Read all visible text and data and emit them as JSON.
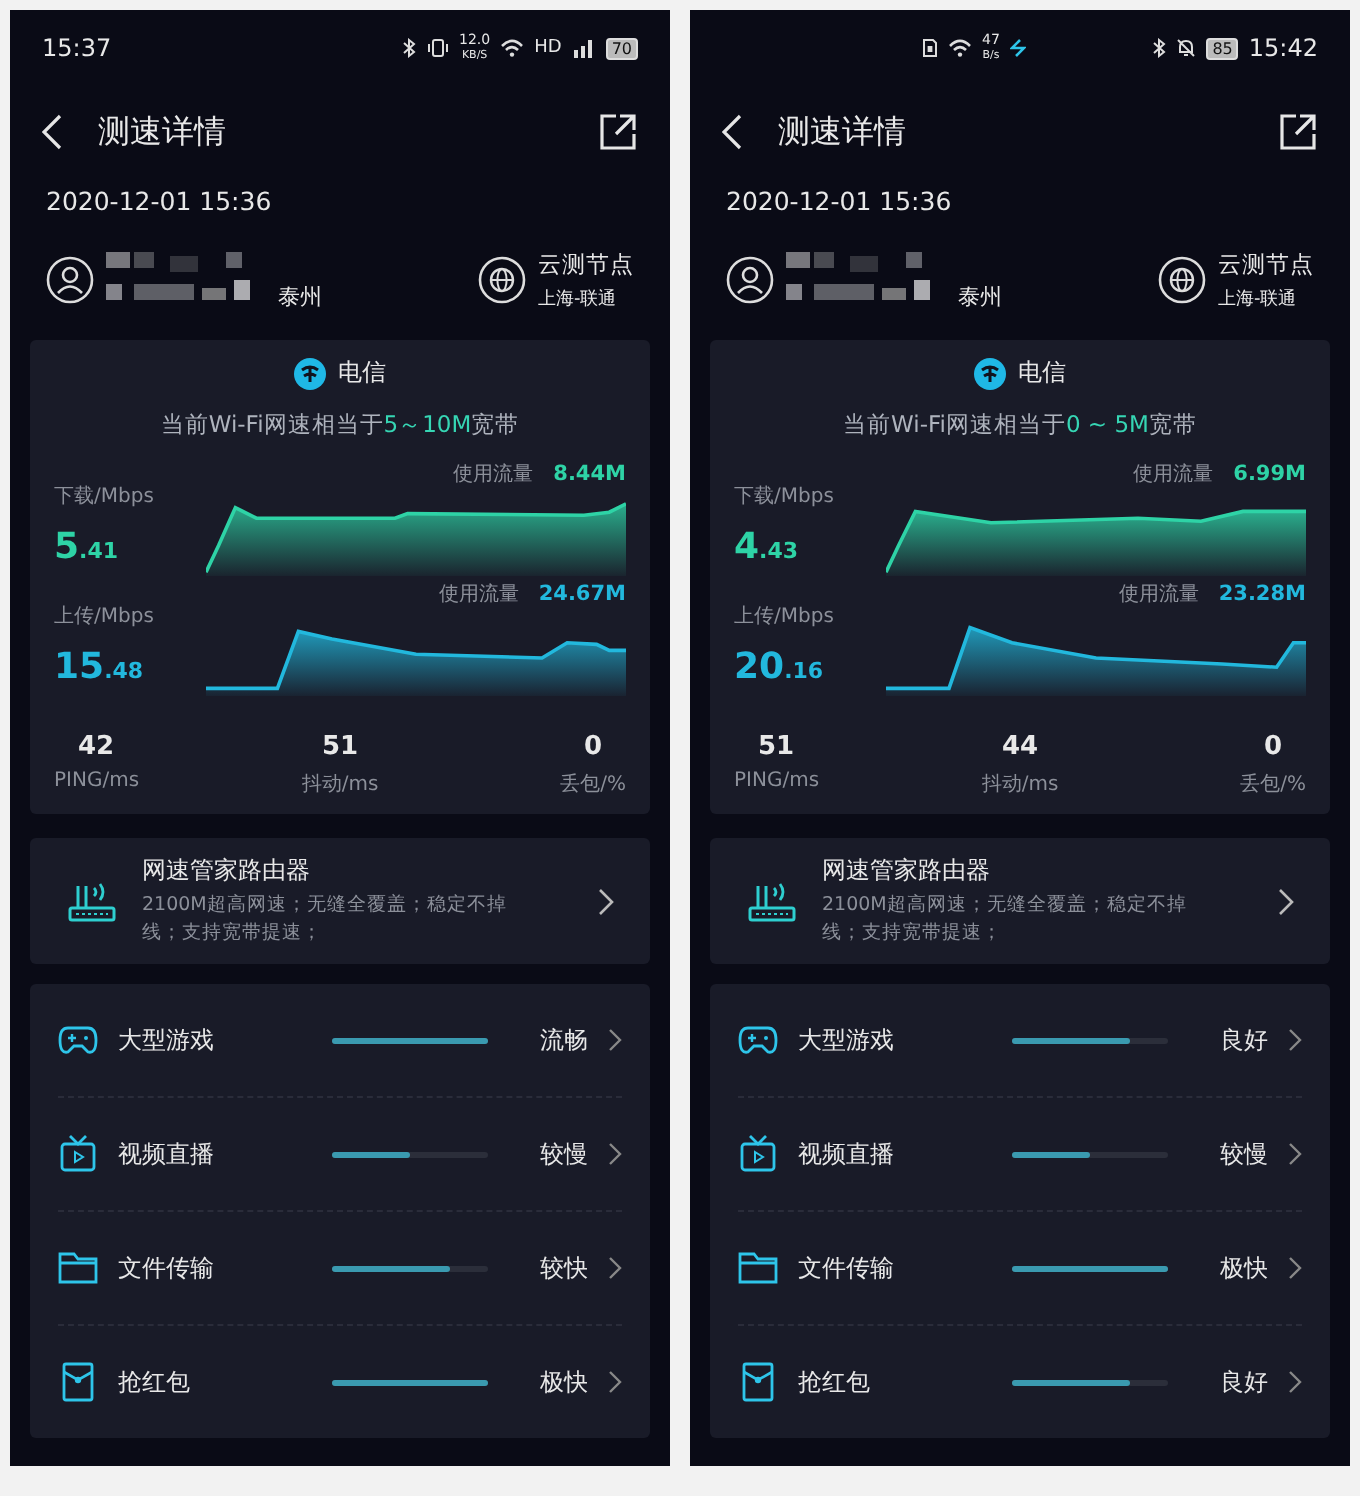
{
  "phones": [
    {
      "status_bar": {
        "kind": "time-left",
        "time": "15:37",
        "network_speed": "12.0",
        "speed_unit": "KB/S",
        "hd": "HD",
        "battery": "70"
      },
      "title": "测速详情",
      "date": "2020-12-01 15:36",
      "user": {
        "location": "泰州"
      },
      "node": {
        "label": "云测节点",
        "value": "上海-联通"
      },
      "isp": "电信",
      "summary": {
        "prefix": "当前Wi-Fi网速相当于",
        "range": "5～10M",
        "suffix": "宽带"
      },
      "download": {
        "label": "下载/Mbps",
        "value_int": "5",
        "value_frac": ".41",
        "usage_label": "使用流量",
        "usage": "8.44M"
      },
      "upload": {
        "label": "上传/Mbps",
        "value_int": "15",
        "value_frac": ".48",
        "usage_label": "使用流量",
        "usage": "24.67M"
      },
      "stats": [
        {
          "value": "42",
          "label": "PING/ms"
        },
        {
          "value": "51",
          "label": "抖动/ms"
        },
        {
          "value": "0",
          "label": "丢包/%"
        }
      ],
      "router": {
        "title": "网速管家路由器",
        "description": "2100M超高网速；无缝全覆盖；稳定不掉线；支持宽带提速；"
      },
      "scenarios": [
        {
          "kind": "game",
          "label": "大型游戏",
          "level": 1.0,
          "rating": "流畅"
        },
        {
          "kind": "video",
          "label": "视频直播",
          "level": 0.5,
          "rating": "较慢"
        },
        {
          "kind": "file",
          "label": "文件传输",
          "level": 0.75,
          "rating": "较快"
        },
        {
          "kind": "envelope",
          "label": "抢红包",
          "level": 1.0,
          "rating": "极快"
        }
      ]
    },
    {
      "status_bar": {
        "kind": "time-right",
        "time": "15:42",
        "network_speed": "47",
        "speed_unit": "B/s",
        "battery": "85"
      },
      "title": "测速详情",
      "date": "2020-12-01 15:36",
      "user": {
        "location": "泰州"
      },
      "node": {
        "label": "云测节点",
        "value": "上海-联通"
      },
      "isp": "电信",
      "summary": {
        "prefix": "当前Wi-Fi网速相当于",
        "range": "0 ~ 5M",
        "suffix": "宽带"
      },
      "download": {
        "label": "下载/Mbps",
        "value_int": "4",
        "value_frac": ".43",
        "usage_label": "使用流量",
        "usage": "6.99M"
      },
      "upload": {
        "label": "上传/Mbps",
        "value_int": "20",
        "value_frac": ".16",
        "usage_label": "使用流量",
        "usage": "23.28M"
      },
      "stats": [
        {
          "value": "51",
          "label": "PING/ms"
        },
        {
          "value": "44",
          "label": "抖动/ms"
        },
        {
          "value": "0",
          "label": "丢包/%"
        }
      ],
      "router": {
        "title": "网速管家路由器",
        "description": "2100M超高网速；无缝全覆盖；稳定不掉线；支持宽带提速；"
      },
      "scenarios": [
        {
          "kind": "game",
          "label": "大型游戏",
          "level": 0.75,
          "rating": "良好"
        },
        {
          "kind": "video",
          "label": "视频直播",
          "level": 0.5,
          "rating": "较慢"
        },
        {
          "kind": "file",
          "label": "文件传输",
          "level": 1.0,
          "rating": "极快"
        },
        {
          "kind": "envelope",
          "label": "抢红包",
          "level": 0.75,
          "rating": "良好"
        }
      ]
    }
  ]
}
